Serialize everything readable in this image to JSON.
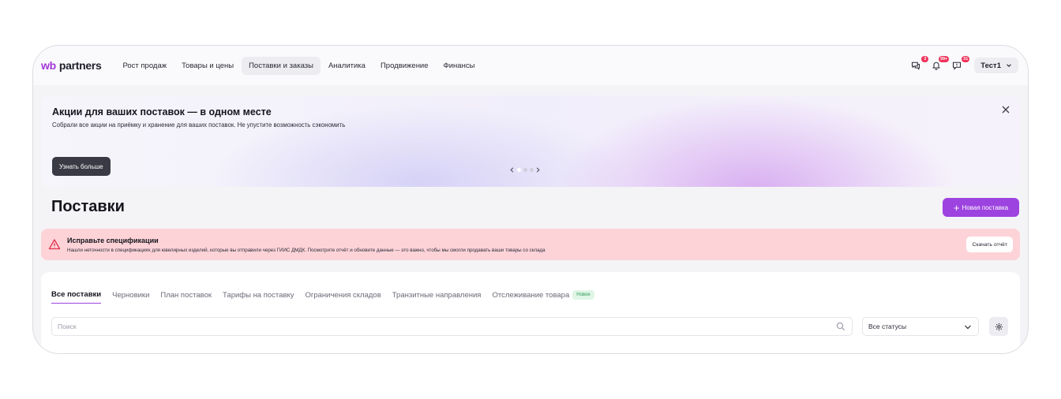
{
  "brand": {
    "wb": "wb",
    "partners": "partners"
  },
  "nav": [
    {
      "label": "Рост продаж"
    },
    {
      "label": "Товары и цены"
    },
    {
      "label": "Поставки и заказы",
      "active": true
    },
    {
      "label": "Аналитика"
    },
    {
      "label": "Продвижение"
    },
    {
      "label": "Финансы"
    }
  ],
  "tools": {
    "chat_badge": "3",
    "bell_badge": "99+",
    "messages_badge": "31",
    "user_label": "Тест1"
  },
  "banner": {
    "title": "Акции для ваших поставок — в одном месте",
    "subtitle": "Собрали все акции на приёмку и хранение для ваших поставок. Не упустите возможность сэкономить",
    "button": "Узнать больше"
  },
  "page": {
    "title": "Поставки",
    "new_button": "Новая поставка"
  },
  "alert": {
    "title": "Исправьте спецификации",
    "text": "Нашли неточности в спецификациях для ювелирных изделий, которые вы отправили через ГИИС ДМДК. Посмотрите отчёт и обновите данные — это важно, чтобы мы смогли продавать ваши товары со склада",
    "button": "Скачать отчёт"
  },
  "tabs": [
    {
      "label": "Все поставки",
      "active": true
    },
    {
      "label": "Черновики"
    },
    {
      "label": "План поставок"
    },
    {
      "label": "Тарифы на поставку"
    },
    {
      "label": "Ограничения складов"
    },
    {
      "label": "Транзитные направления"
    },
    {
      "label": "Отслеживание товара",
      "badge": "Новое"
    }
  ],
  "filters": {
    "search_placeholder": "Поиск",
    "status_value": "Все статусы"
  },
  "colors": {
    "accent": "#9d43e0",
    "alert_bg": "#fdd3d8",
    "badge": "#f0325a",
    "new_badge_bg": "#dff5e6"
  }
}
